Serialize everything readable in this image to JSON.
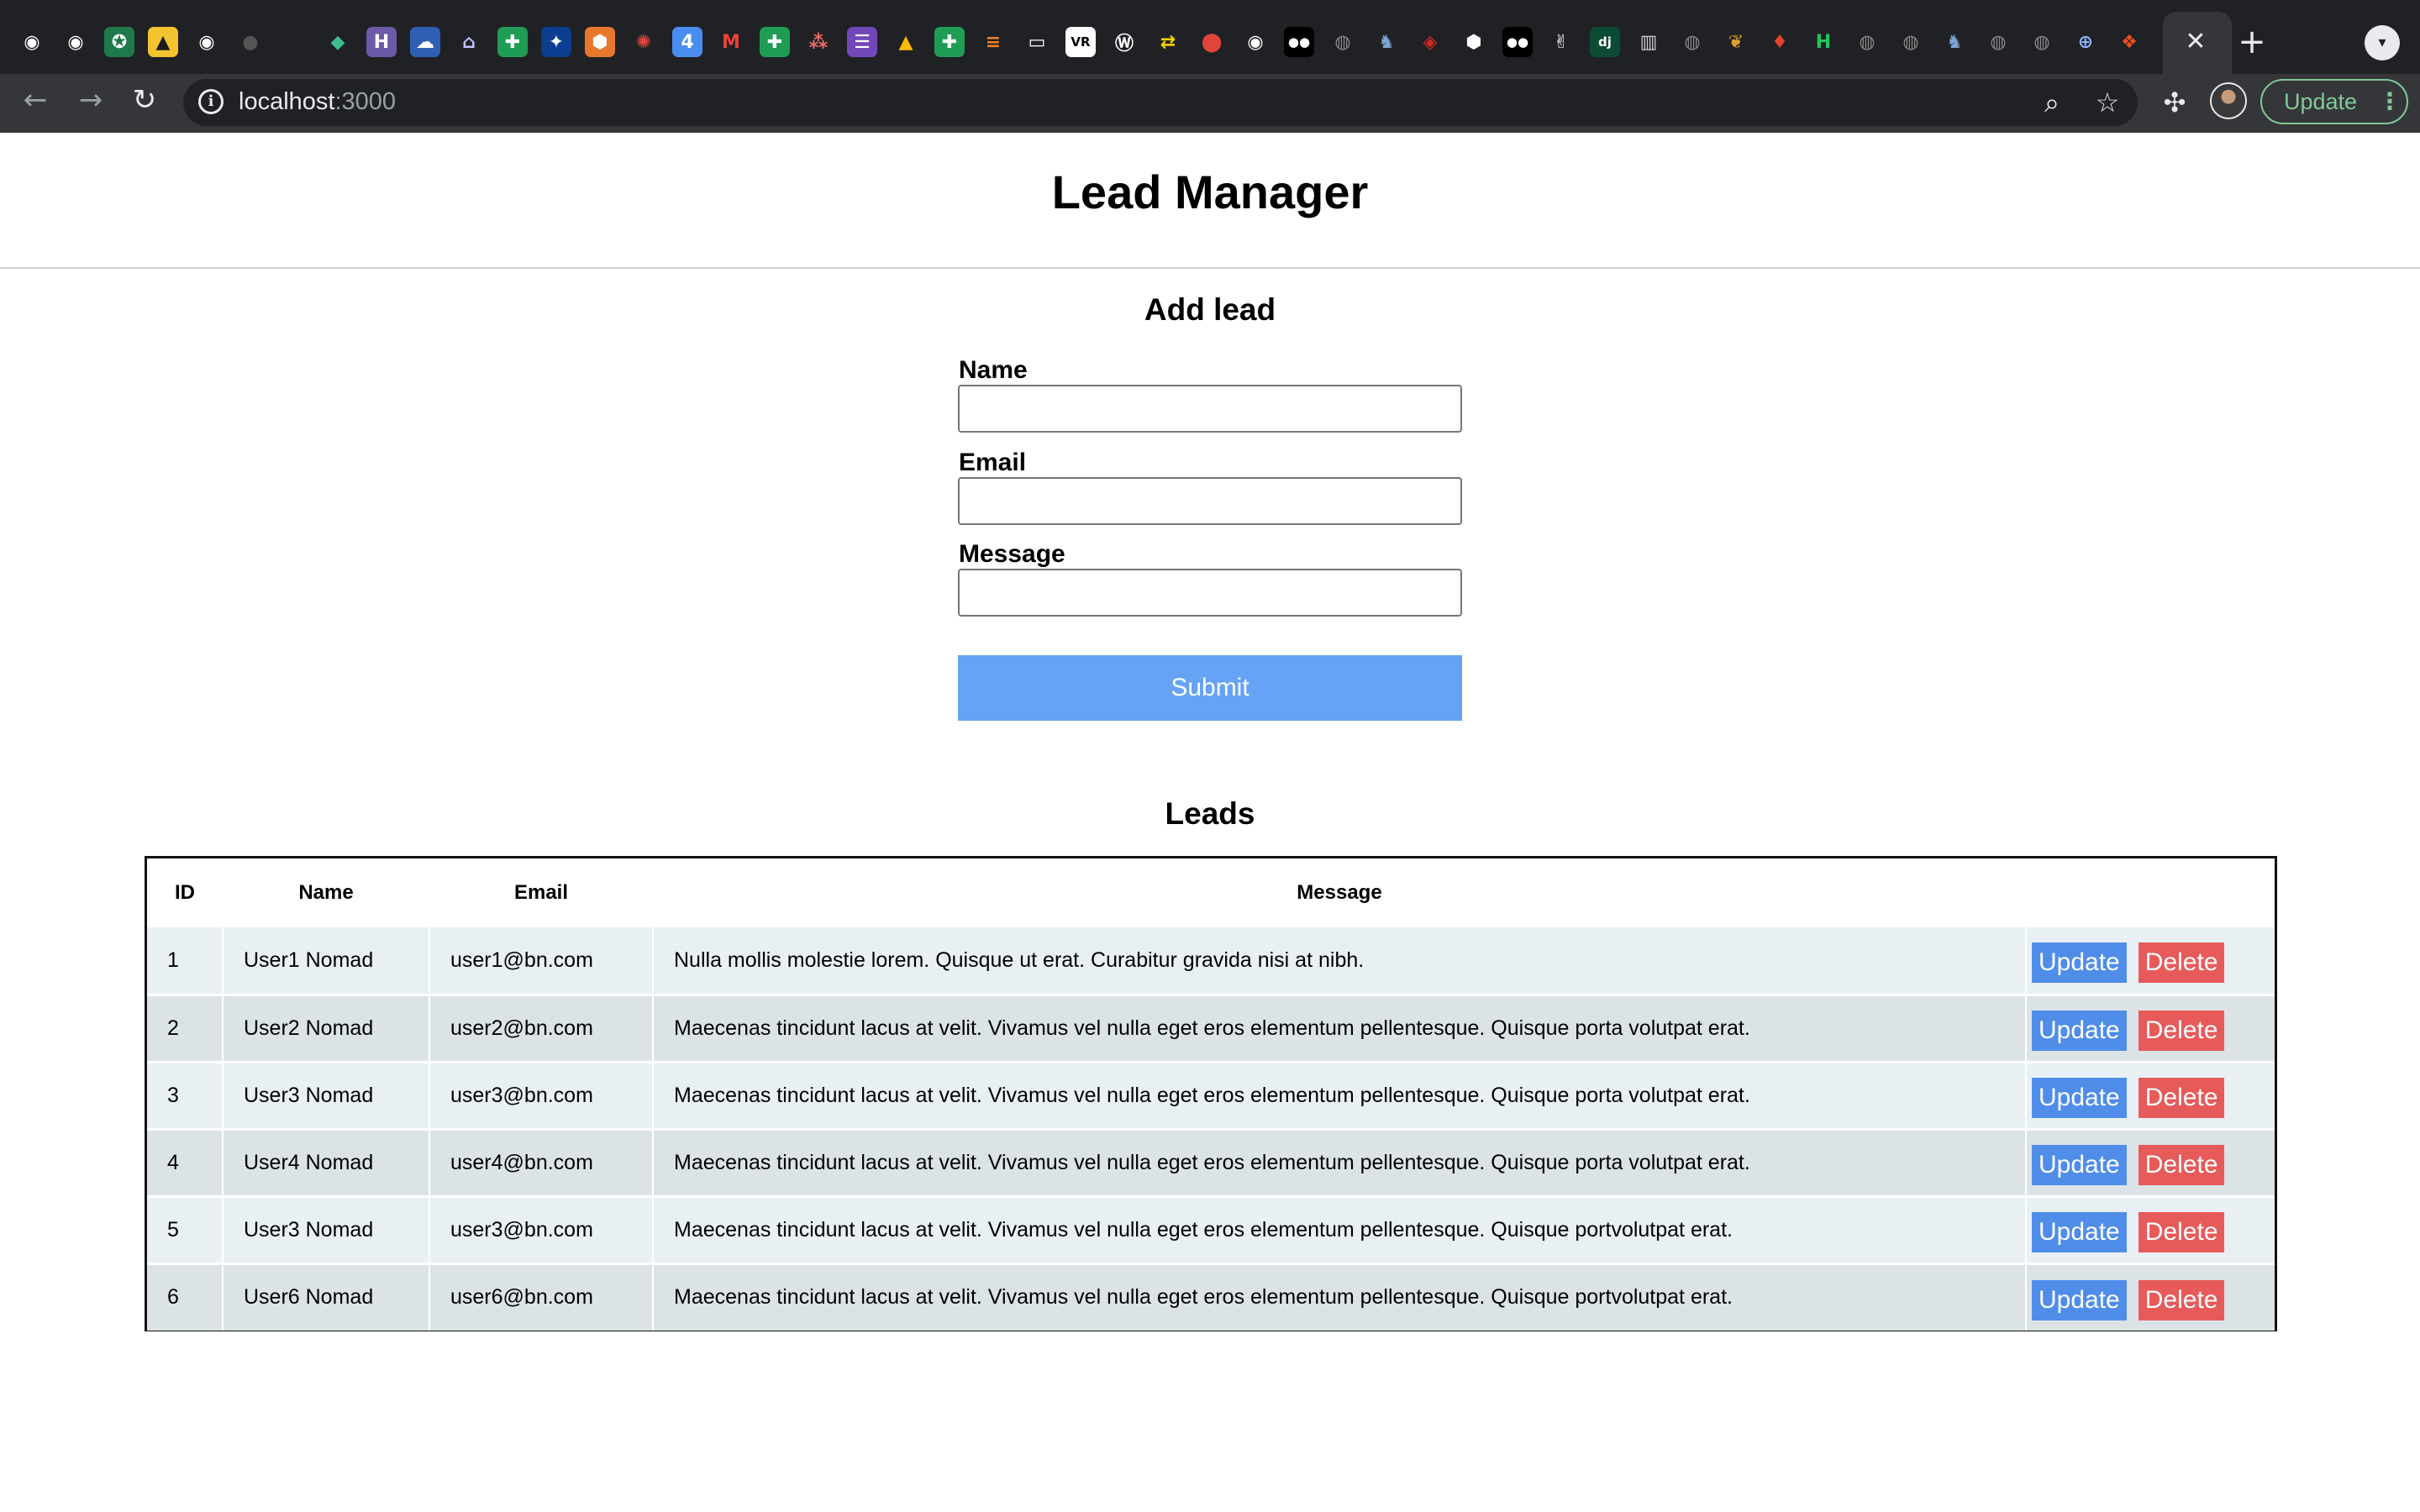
{
  "browser": {
    "favicons": [
      {
        "name": "github-icon",
        "bg": "#202124",
        "fg": "#ffffff",
        "glyph": "◉"
      },
      {
        "name": "github-icon",
        "bg": "#202124",
        "fg": "#ffffff",
        "glyph": "◉"
      },
      {
        "name": "starbucks-icon",
        "bg": "#1e7a4c",
        "fg": "#ffffff",
        "glyph": "✪"
      },
      {
        "name": "image-icon",
        "bg": "#f4c430",
        "fg": "#1a1a1a",
        "glyph": "▲"
      },
      {
        "name": "github-icon",
        "bg": "#202124",
        "fg": "#ffffff",
        "glyph": "◉"
      },
      {
        "name": "dark-circle-icon",
        "bg": "#202124",
        "fg": "#555555",
        "glyph": "●"
      },
      {
        "name": "blank-tab-icon",
        "bg": "#202124",
        "fg": "#202124",
        "glyph": "·"
      },
      {
        "name": "diamond-icon",
        "bg": "#202124",
        "fg": "#3cbf8f",
        "glyph": "◆"
      },
      {
        "name": "heroku-icon",
        "bg": "#6c5aa8",
        "fg": "#ffffff",
        "glyph": "H"
      },
      {
        "name": "cloud-icon",
        "bg": "#2f5fb3",
        "fg": "#ffffff",
        "glyph": "☁"
      },
      {
        "name": "arch-icon",
        "bg": "#202124",
        "fg": "#c0c0ff",
        "glyph": "⌂"
      },
      {
        "name": "sheets-icon",
        "bg": "#1f9d55",
        "fg": "#ffffff",
        "glyph": "✚"
      },
      {
        "name": "nasa-icon",
        "bg": "#0b3d91",
        "fg": "#ffffff",
        "glyph": "✦"
      },
      {
        "name": "package-icon",
        "bg": "#e8772e",
        "fg": "#ffffff",
        "glyph": "⬢"
      },
      {
        "name": "gear-red-icon",
        "bg": "#202124",
        "fg": "#e0443b",
        "glyph": "✺"
      },
      {
        "name": "calendar-icon",
        "bg": "#4a8df0",
        "fg": "#ffffff",
        "glyph": "4"
      },
      {
        "name": "gmail-icon",
        "bg": "#202124",
        "fg": "#ea4335",
        "glyph": "M"
      },
      {
        "name": "sheets-icon",
        "bg": "#1f9d55",
        "fg": "#ffffff",
        "glyph": "✚"
      },
      {
        "name": "asana-icon",
        "bg": "#202124",
        "fg": "#f06a6a",
        "glyph": "⁂"
      },
      {
        "name": "forms-icon",
        "bg": "#7248b9",
        "fg": "#ffffff",
        "glyph": "☰"
      },
      {
        "name": "drive-icon",
        "bg": "#202124",
        "fg": "#fbbc04",
        "glyph": "▲"
      },
      {
        "name": "sheets-icon",
        "bg": "#1f9d55",
        "fg": "#ffffff",
        "glyph": "✚"
      },
      {
        "name": "stackoverflow-icon",
        "bg": "#202124",
        "fg": "#f48024",
        "glyph": "≡"
      },
      {
        "name": "chat-icon",
        "bg": "#202124",
        "fg": "#ffffff",
        "glyph": "▭"
      },
      {
        "name": "vr-icon",
        "bg": "#ffffff",
        "fg": "#000000",
        "glyph": "VR"
      },
      {
        "name": "wordpress-icon",
        "bg": "#202124",
        "fg": "#ffffff",
        "glyph": "Ⓦ"
      },
      {
        "name": "shuffle-icon",
        "bg": "#202124",
        "fg": "#f5d300",
        "glyph": "⇄"
      },
      {
        "name": "redpin-icon",
        "bg": "#202124",
        "fg": "#e0443b",
        "glyph": "⬤"
      },
      {
        "name": "github-icon",
        "bg": "#202124",
        "fg": "#ffffff",
        "glyph": "◉"
      },
      {
        "name": "medium-icon",
        "bg": "#000000",
        "fg": "#ffffff",
        "glyph": "●●"
      },
      {
        "name": "globe-gray-icon",
        "bg": "#202124",
        "fg": "#8a8a8a",
        "glyph": "◍"
      },
      {
        "name": "postgres-icon",
        "bg": "#202124",
        "fg": "#7fa7d6",
        "glyph": "♞"
      },
      {
        "name": "redis-icon",
        "bg": "#202124",
        "fg": "#d82c20",
        "glyph": "◈"
      },
      {
        "name": "hexagon-icon",
        "bg": "#202124",
        "fg": "#ffffff",
        "glyph": "⬢"
      },
      {
        "name": "medium-icon",
        "bg": "#000000",
        "fg": "#ffffff",
        "glyph": "●●"
      },
      {
        "name": "hand-icon",
        "bg": "#202124",
        "fg": "#ffffff",
        "glyph": "✌"
      },
      {
        "name": "django-icon",
        "bg": "#0c4b33",
        "fg": "#ffffff",
        "glyph": "dj"
      },
      {
        "name": "book-icon",
        "bg": "#202124",
        "fg": "#cfcfcf",
        "glyph": "▥"
      },
      {
        "name": "globe-gray-icon",
        "bg": "#202124",
        "fg": "#8a8a8a",
        "glyph": "◍"
      },
      {
        "name": "africa-icon",
        "bg": "#202124",
        "fg": "#e0a030",
        "glyph": "❦"
      },
      {
        "name": "gitlab-icon",
        "bg": "#202124",
        "fg": "#e24329",
        "glyph": "♦"
      },
      {
        "name": "hi-icon",
        "bg": "#202124",
        "fg": "#22c55e",
        "glyph": "H"
      },
      {
        "name": "globe-gray-icon",
        "bg": "#202124",
        "fg": "#8a8a8a",
        "glyph": "◍"
      },
      {
        "name": "globe-gray-icon",
        "bg": "#202124",
        "fg": "#8a8a8a",
        "glyph": "◍"
      },
      {
        "name": "postgres-icon",
        "bg": "#202124",
        "fg": "#7fa7d6",
        "glyph": "♞"
      },
      {
        "name": "globe-gray-icon",
        "bg": "#202124",
        "fg": "#8a8a8a",
        "glyph": "◍"
      },
      {
        "name": "globe-gray-icon",
        "bg": "#202124",
        "fg": "#8a8a8a",
        "glyph": "◍"
      },
      {
        "name": "globe-blue-icon",
        "bg": "#202124",
        "fg": "#8ab4f8",
        "glyph": "⊕"
      },
      {
        "name": "figma-icon",
        "bg": "#202124",
        "fg": "#f24e1e",
        "glyph": "❖"
      },
      {
        "name": "gitlab-icon",
        "bg": "#202124",
        "fg": "#e24329",
        "glyph": "♦"
      }
    ],
    "active_tab_close_glyph": "✕",
    "new_tab_glyph": "+",
    "tab_search_glyph": "▾",
    "back_glyph": "←",
    "forward_glyph": "→",
    "reload_glyph": "↻",
    "info_glyph": "i",
    "url_host": "localhost",
    "url_port": ":3000",
    "zoom_glyph": "⌕",
    "star_glyph": "☆",
    "extensions_glyph": "✣",
    "update_label": "Update",
    "menu_glyph": "⋮"
  },
  "page": {
    "title": "Lead Manager"
  },
  "form": {
    "title": "Add lead",
    "name_label": "Name",
    "email_label": "Email",
    "message_label": "Message",
    "name_value": "",
    "email_value": "",
    "message_value": "",
    "submit_label": "Submit"
  },
  "leads": {
    "title": "Leads",
    "columns": [
      "ID",
      "Name",
      "Email",
      "Message",
      ""
    ],
    "update_label": "Update",
    "delete_label": "Delete",
    "rows": [
      {
        "id": "1",
        "name": "User1 Nomad",
        "email": "user1@bn.com",
        "message": "Nulla mollis molestie lorem. Quisque ut erat. Curabitur gravida nisi at nibh."
      },
      {
        "id": "2",
        "name": "User2 Nomad",
        "email": "user2@bn.com",
        "message": "Maecenas tincidunt lacus at velit. Vivamus vel nulla eget eros elementum pellentesque. Quisque porta volutpat erat."
      },
      {
        "id": "3",
        "name": "User3 Nomad",
        "email": "user3@bn.com",
        "message": "Maecenas tincidunt lacus at velit. Vivamus vel nulla eget eros elementum pellentesque. Quisque porta volutpat erat."
      },
      {
        "id": "4",
        "name": "User4 Nomad",
        "email": "user4@bn.com",
        "message": "Maecenas tincidunt lacus at velit. Vivamus vel nulla eget eros elementum pellentesque. Quisque porta volutpat erat."
      },
      {
        "id": "5",
        "name": "User3 Nomad",
        "email": "user3@bn.com",
        "message": "Maecenas tincidunt lacus at velit. Vivamus vel nulla eget eros elementum pellentesque. Quisque portvolutpat erat."
      },
      {
        "id": "6",
        "name": "User6 Nomad",
        "email": "user6@bn.com",
        "message": "Maecenas tincidunt lacus at velit. Vivamus vel nulla eget eros elementum pellentesque. Quisque portvolutpat erat."
      }
    ]
  },
  "colors": {
    "chrome_dark": "#202124",
    "chrome_toolbar": "#35363a",
    "submit_blue": "#66a3f4",
    "update_blue": "#4f8de9",
    "delete_red": "#e65a5a",
    "row_odd": "#e9f0f3",
    "row_even": "#dce3e6"
  }
}
